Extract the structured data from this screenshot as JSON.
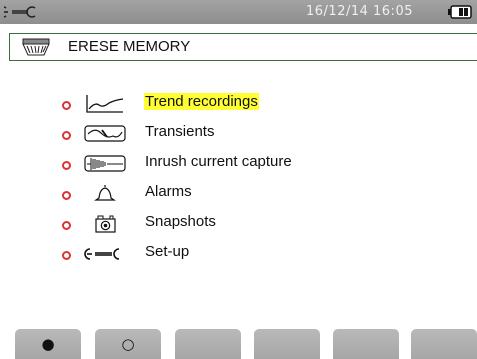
{
  "status_bar": {
    "datetime": "16/12/14 16:05",
    "icons": [
      "setup-wrench-icon",
      "battery-icon"
    ]
  },
  "title": {
    "text": "ERESE MEMORY",
    "icon": "eraser-icon"
  },
  "menu": {
    "selected_index": 0,
    "highlight_color": "#ffff33",
    "bullet_color": "#e03030",
    "items": [
      {
        "label": "Trend recordings",
        "icon": "trend-graph-icon"
      },
      {
        "label": "Transients",
        "icon": "transient-wave-icon"
      },
      {
        "label": "Inrush current capture",
        "icon": "inrush-signal-icon"
      },
      {
        "label": "Alarms",
        "icon": "bell-icon"
      },
      {
        "label": "Snapshots",
        "icon": "camera-icon"
      },
      {
        "label": "Set-up",
        "icon": "setup-wrench-icon"
      }
    ]
  },
  "function_keys": [
    {
      "glyph": "●",
      "name": "filled-circle"
    },
    {
      "glyph": "○",
      "name": "empty-circle"
    },
    {
      "glyph": "",
      "name": "blank"
    },
    {
      "glyph": "",
      "name": "blank"
    },
    {
      "glyph": "",
      "name": "blank"
    },
    {
      "glyph": "",
      "name": "blank"
    }
  ]
}
